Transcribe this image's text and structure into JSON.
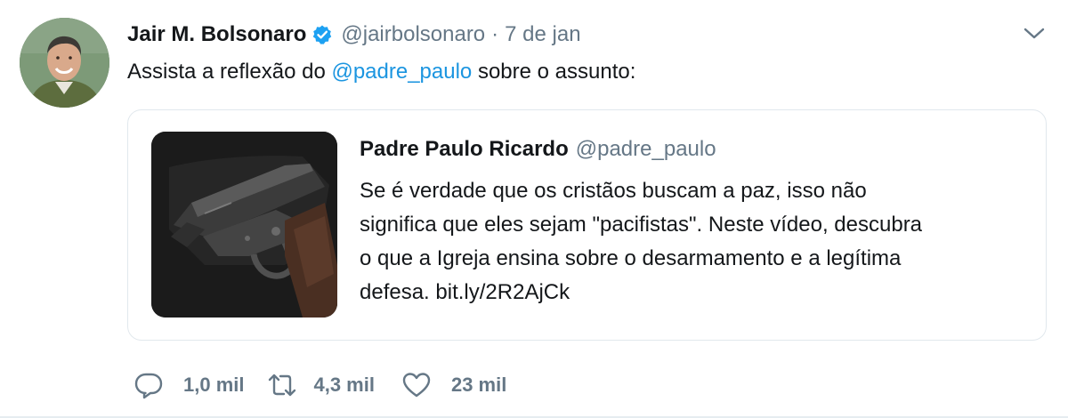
{
  "tweet": {
    "author": {
      "name": "Jair M. Bolsonaro",
      "handle": "@jairbolsonaro",
      "separator": "·",
      "time": "7 de jan"
    },
    "text_before": "Assista a reflexão do ",
    "text_mention": "@padre_paulo",
    "text_after": " sobre o assunto:",
    "quoted": {
      "name": "Padre Paulo Ricardo",
      "handle": "@padre_paulo",
      "lines": [
        "Se é verdade que os cristãos buscam a paz, isso não",
        "significa que eles sejam \"pacifistas\". Neste vídeo, descubra",
        "o que a Igreja ensina sobre o desarmamento e a legítima",
        "defesa. bit.ly/2R2AjCk"
      ]
    },
    "actions": {
      "reply_count": "1,0 mil",
      "retweet_count": "4,3 mil",
      "like_count": "23 mil"
    }
  },
  "colors": {
    "text": "#14171a",
    "secondary": "#657786",
    "link": "#1b95e0",
    "verified": "#1da1f2",
    "border": "#e1e8ed"
  },
  "icons": [
    "verified-badge-icon",
    "chevron-down-icon",
    "reply-icon",
    "retweet-icon",
    "like-icon"
  ]
}
